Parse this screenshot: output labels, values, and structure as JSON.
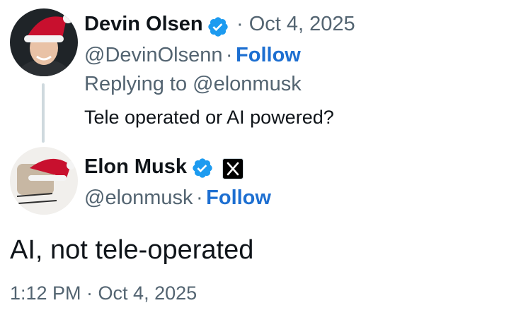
{
  "reply": {
    "author_name": "Devin Olsen",
    "separator": "·",
    "date": "Oct 4, 2025",
    "handle": "@DevinOlsenn",
    "follow_label": "Follow",
    "replying_to_prefix": "Replying to",
    "replying_to_handle": "@elonmusk",
    "text": "Tele operated or AI powered?"
  },
  "post": {
    "author_name": "Elon Musk",
    "handle": "@elonmusk",
    "separator": "·",
    "follow_label": "Follow",
    "text": "AI, not tele-operated",
    "timestamp": "1:12 PM · Oct 4, 2025"
  },
  "colors": {
    "accent": "#1d6fd1",
    "verified": "#1d9bf0",
    "muted": "#536471",
    "thread_line": "#cfd9de"
  },
  "icons": {
    "verified": "verified-badge-icon",
    "affiliate": "x-logo-icon"
  }
}
